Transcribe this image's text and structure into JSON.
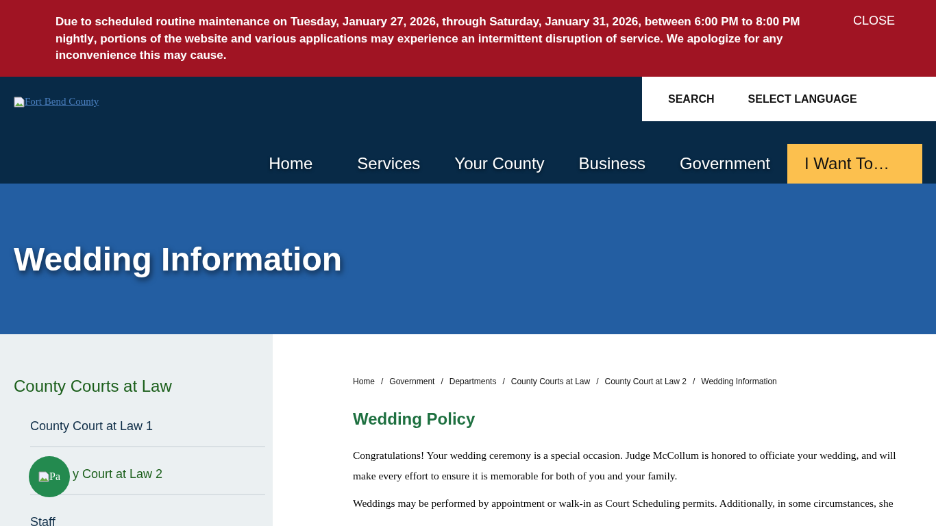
{
  "alert": {
    "message": "Due to scheduled routine maintenance on **Tuesday, January 27, 2026, through Saturday, January 31, 2026, between 6:00 PM to 8:00 PM nightly**, portions of the website and various applications may experience an intermittent disruption of service. We apologize for any inconvenience this may cause.",
    "close": "CLOSE"
  },
  "header": {
    "logo_alt": "Fort Bend County",
    "utility": [
      "SEARCH",
      "SELECT LANGUAGE"
    ],
    "nav": [
      {
        "label": "Home",
        "selected": false
      },
      {
        "label": "Services",
        "selected": false
      },
      {
        "label": "Your County",
        "selected": false
      },
      {
        "label": "Business",
        "selected": false
      },
      {
        "label": "Government",
        "selected": false
      },
      {
        "label": "I Want To…",
        "selected": true
      }
    ]
  },
  "banner": {
    "title": "Wedding Information"
  },
  "sidebar": {
    "title": "County Courts at Law",
    "items": [
      {
        "label": "County Court at Law 1",
        "selected": false
      },
      {
        "label": "y Court at Law 2",
        "selected": true
      },
      {
        "label": "Staff",
        "selected": false
      }
    ]
  },
  "breadcrumb": [
    {
      "label": "Home"
    },
    {
      "separator": "/",
      "label": "Government"
    },
    {
      "separator": "/",
      "label": "Departments"
    },
    {
      "separator": "/",
      "label": "County Courts at Law"
    },
    {
      "separator": "/",
      "label": "County Court at Law 2"
    },
    {
      "separator": "/",
      "label": "Wedding Information"
    }
  ],
  "content": {
    "heading": "Wedding Policy",
    "paragraphs": [
      "Congratulations! Your wedding ceremony is a special occasion. Judge McCollum is honored to officiate your wedding, and will make every effort to ensure it is memorable for both of you and your family.",
      "Weddings may be performed by appointment or walk-in as Court Scheduling permits. Additionally, in some circumstances, she"
    ]
  },
  "assist_button": {
    "alt": "Pa"
  }
}
